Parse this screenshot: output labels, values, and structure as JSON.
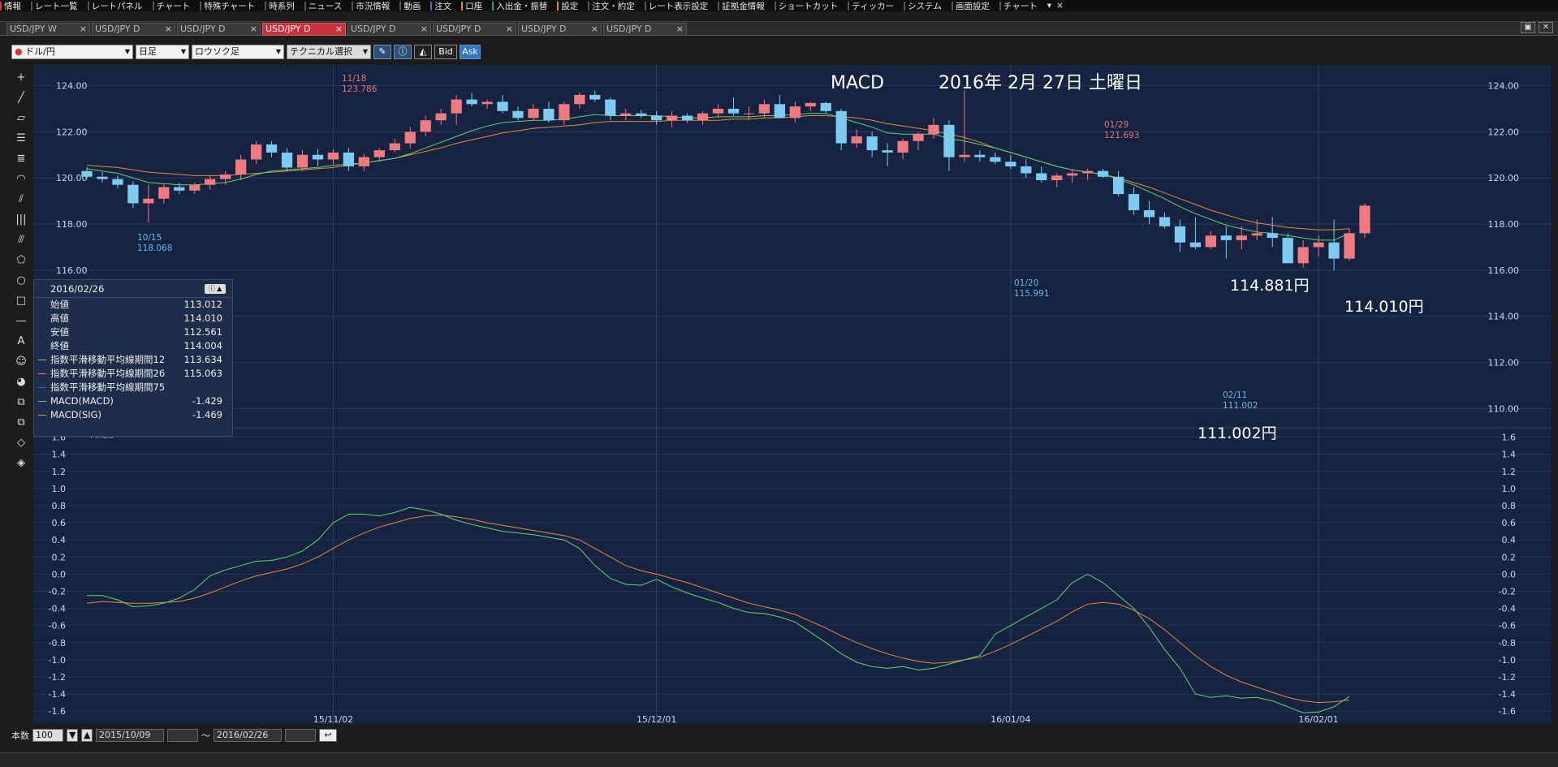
{
  "menu": [
    {
      "label": "情報",
      "color": "#d23b3b"
    },
    {
      "label": "レート一覧",
      "color": ""
    },
    {
      "label": "レートパネル",
      "color": ""
    },
    {
      "label": "チャート",
      "color": ""
    },
    {
      "label": "特殊チャート",
      "color": ""
    },
    {
      "label": "時系列",
      "color": ""
    },
    {
      "label": "ニュース",
      "color": ""
    },
    {
      "label": "市況情報",
      "color": ""
    },
    {
      "label": "動画",
      "color": ""
    },
    {
      "label": "注文",
      "color": "#9a49c9"
    },
    {
      "label": "口座",
      "color": "#e28a1f"
    },
    {
      "label": "入出金・振替",
      "color": "#3aa848"
    },
    {
      "label": "設定",
      "color": "#e28a1f"
    },
    {
      "label": "注文・約定",
      "color": ""
    },
    {
      "label": "レート表示設定",
      "color": ""
    },
    {
      "label": "証拠金情報",
      "color": ""
    },
    {
      "label": "ショートカット",
      "color": ""
    },
    {
      "label": "ティッカー",
      "color": ""
    },
    {
      "label": "システム",
      "color": ""
    },
    {
      "label": "画面設定",
      "color": ""
    },
    {
      "label": "チャート",
      "color": ""
    }
  ],
  "menu_extra": [
    "▾",
    "×"
  ],
  "tabs": [
    {
      "label": "USD/JPY W",
      "active": false
    },
    {
      "label": "USD/JPY D",
      "active": false
    },
    {
      "label": "USD/JPY D",
      "active": false
    },
    {
      "label": "USD/JPY D",
      "active": true
    },
    {
      "label": "USD/JPY D",
      "active": false
    },
    {
      "label": "USD/JPY D",
      "active": false
    },
    {
      "label": "USD/JPY D",
      "active": false
    },
    {
      "label": "USD/JPY D",
      "active": false
    }
  ],
  "tab_close": "×",
  "toolbar": {
    "currency": "ドル/円",
    "period": "日足",
    "chart_type": "ロウソク足",
    "technical": "テクニカル選択",
    "bid": "Bid",
    "ask": "Ask"
  },
  "left_tools": [
    "crosshair-icon",
    "line-icon",
    "ruler-icon",
    "horizontal-lines-icon",
    "multi-lines-icon",
    "arc-icon",
    "fan-icon",
    "vertical-lines-icon",
    "pitchfork-icon",
    "pentagon-icon",
    "circle-icon",
    "rectangle-icon",
    "hline-icon",
    "text-icon",
    "icon-stamp-icon",
    "color-icon",
    "copy-icon",
    "paste-icon",
    "eraser-icon",
    "eraser-all-icon"
  ],
  "left_tool_glyphs": [
    "+",
    "╱",
    "▱",
    "☰",
    "≣",
    "◠",
    "⫽",
    "|||",
    "⫻",
    "⬠",
    "○",
    "□",
    "—",
    "A",
    "☺",
    "◕",
    "⧉",
    "⧉",
    "◇",
    "◈"
  ],
  "annotations": {
    "title": "MACD",
    "date": "2016年 2月 27日 土曜日",
    "label_114881": "114.881円",
    "label_114010": "114.010円",
    "label_111002": "111.002円"
  },
  "markers": [
    {
      "date": "11/18",
      "price": "123.786",
      "color": "#e8707a"
    },
    {
      "date": "10/15",
      "price": "118.068",
      "color": "#6ab8e8"
    },
    {
      "date": "01/29",
      "price": "121.693",
      "color": "#e8707a"
    },
    {
      "date": "01/20",
      "price": "115.991",
      "color": "#6ab8e8"
    },
    {
      "date": "02/11",
      "price": "111.002",
      "color": "#6ab8e8"
    }
  ],
  "info_panel": {
    "date": "2016/02/26",
    "rows": [
      {
        "label": "始値",
        "value": "113.012",
        "color": ""
      },
      {
        "label": "高値",
        "value": "114.010",
        "color": ""
      },
      {
        "label": "安値",
        "value": "112.561",
        "color": ""
      },
      {
        "label": "終値",
        "value": "114.004",
        "color": ""
      },
      {
        "label": "指数平滑移動平均線期間12",
        "value": "113.634",
        "color": "#5fd66b"
      },
      {
        "label": "指数平滑移動平均線期間26",
        "value": "115.063",
        "color": "#e88a3a"
      },
      {
        "label": "指数平滑移動平均線期間75",
        "value": "",
        "color": "#3a5ae8"
      },
      {
        "label": "MACD(MACD)",
        "value": "-1.429",
        "color": "#5fd66b"
      },
      {
        "label": "MACD(SIG)",
        "value": "-1.469",
        "color": "#e88a3a"
      }
    ]
  },
  "macd_label": "MACD",
  "footer": {
    "count_label": "本数",
    "count_value": "100",
    "start_date": "2015/10/09",
    "tilde": "〜",
    "end_date": "2016/02/26"
  },
  "colors": {
    "chart_bg": "#152240",
    "up": "#f07a80",
    "down": "#7ccbf0",
    "ema12": "#5fd66b",
    "ema26": "#e88a3a"
  },
  "chart_data": {
    "type": "candlestick+macd",
    "x_ticks": [
      "15/11/02",
      "15/12/01",
      "16/01/04",
      "16/02/01"
    ],
    "x_tick_index": [
      16,
      37,
      60,
      80
    ],
    "price_ylim": [
      109.2,
      124.9
    ],
    "price_ticks": [
      "124.00",
      "122.00",
      "120.00",
      "118.00",
      "116.00",
      "114.00",
      "112.00",
      "110.00"
    ],
    "macd_ylim": [
      -1.75,
      1.7
    ],
    "macd_ticks": [
      "1.6",
      "1.4",
      "1.2",
      "1.0",
      "0.8",
      "0.6",
      "0.4",
      "0.2",
      "0.0",
      "-0.2",
      "-0.4",
      "-0.6",
      "-0.8",
      "-1.0",
      "-1.2",
      "-1.4",
      "-1.6"
    ],
    "candles": [
      [
        120.3,
        120.45,
        119.95,
        120.05
      ],
      [
        120.05,
        120.25,
        119.8,
        119.95
      ],
      [
        119.95,
        120.1,
        119.55,
        119.7
      ],
      [
        119.7,
        119.85,
        118.7,
        118.9
      ],
      [
        118.9,
        119.7,
        118.07,
        119.1
      ],
      [
        119.1,
        119.75,
        118.9,
        119.6
      ],
      [
        119.6,
        119.8,
        119.3,
        119.45
      ],
      [
        119.45,
        119.8,
        119.3,
        119.7
      ],
      [
        119.7,
        120.1,
        119.5,
        119.95
      ],
      [
        119.95,
        120.3,
        119.7,
        120.15
      ],
      [
        120.15,
        121.0,
        119.9,
        120.8
      ],
      [
        120.8,
        121.6,
        120.6,
        121.45
      ],
      [
        121.45,
        121.6,
        120.9,
        121.1
      ],
      [
        121.1,
        121.3,
        120.3,
        120.45
      ],
      [
        120.45,
        121.2,
        120.3,
        121.0
      ],
      [
        121.0,
        121.25,
        120.5,
        120.8
      ],
      [
        120.8,
        121.25,
        120.6,
        121.1
      ],
      [
        121.1,
        121.3,
        120.3,
        120.5
      ],
      [
        120.5,
        121.05,
        120.3,
        120.9
      ],
      [
        120.9,
        121.3,
        120.7,
        121.2
      ],
      [
        121.2,
        121.7,
        121.1,
        121.5
      ],
      [
        121.5,
        122.2,
        121.3,
        122.0
      ],
      [
        122.0,
        122.7,
        121.8,
        122.5
      ],
      [
        122.5,
        123.0,
        122.3,
        122.8
      ],
      [
        122.8,
        123.6,
        122.3,
        123.4
      ],
      [
        123.4,
        123.7,
        123.1,
        123.2
      ],
      [
        123.2,
        123.4,
        123.0,
        123.3
      ],
      [
        123.3,
        123.6,
        122.8,
        122.9
      ],
      [
        122.9,
        123.1,
        122.5,
        122.6
      ],
      [
        122.6,
        123.2,
        122.5,
        123.0
      ],
      [
        123.0,
        123.3,
        122.4,
        122.5
      ],
      [
        122.5,
        123.3,
        122.3,
        123.2
      ],
      [
        123.2,
        123.7,
        123.0,
        123.6
      ],
      [
        123.6,
        123.79,
        123.3,
        123.4
      ],
      [
        123.4,
        123.5,
        122.5,
        122.7
      ],
      [
        122.7,
        123.0,
        122.5,
        122.8
      ],
      [
        122.8,
        122.95,
        122.6,
        122.7
      ],
      [
        122.7,
        122.9,
        122.3,
        122.5
      ],
      [
        122.5,
        122.9,
        122.2,
        122.7
      ],
      [
        122.7,
        122.8,
        122.4,
        122.5
      ],
      [
        122.5,
        122.9,
        122.3,
        122.8
      ],
      [
        122.8,
        123.2,
        122.6,
        123.0
      ],
      [
        123.0,
        123.5,
        122.7,
        122.8
      ],
      [
        122.8,
        123.1,
        122.5,
        122.8
      ],
      [
        122.8,
        123.4,
        122.6,
        123.2
      ],
      [
        123.2,
        123.6,
        122.6,
        122.6
      ],
      [
        122.6,
        123.3,
        122.4,
        123.1
      ],
      [
        123.1,
        123.3,
        122.9,
        123.25
      ],
      [
        123.25,
        123.3,
        122.8,
        122.9
      ],
      [
        122.9,
        123.0,
        121.2,
        121.5
      ],
      [
        121.5,
        122.1,
        121.3,
        121.8
      ],
      [
        121.8,
        122.0,
        120.9,
        121.2
      ],
      [
        121.2,
        121.5,
        120.5,
        121.1
      ],
      [
        121.1,
        121.7,
        120.8,
        121.6
      ],
      [
        121.6,
        122.0,
        121.2,
        121.9
      ],
      [
        121.9,
        122.6,
        121.7,
        122.3
      ],
      [
        122.3,
        122.5,
        120.3,
        120.9
      ],
      [
        120.9,
        123.8,
        120.7,
        121.0
      ],
      [
        121.0,
        121.2,
        120.7,
        120.9
      ],
      [
        120.9,
        121.1,
        120.6,
        120.7
      ],
      [
        120.7,
        121.0,
        120.4,
        120.5
      ],
      [
        120.5,
        120.8,
        120.0,
        120.2
      ],
      [
        120.2,
        120.5,
        119.8,
        119.9
      ],
      [
        119.9,
        120.2,
        119.6,
        120.1
      ],
      [
        120.1,
        120.4,
        119.8,
        120.2
      ],
      [
        120.2,
        120.4,
        119.9,
        120.3
      ],
      [
        120.3,
        120.4,
        120.0,
        120.05
      ],
      [
        120.05,
        120.3,
        119.2,
        119.3
      ],
      [
        119.3,
        119.6,
        118.4,
        118.6
      ],
      [
        118.6,
        119.0,
        118.0,
        118.3
      ],
      [
        118.3,
        118.5,
        117.8,
        117.9
      ],
      [
        117.9,
        118.2,
        116.8,
        117.2
      ],
      [
        117.2,
        118.3,
        116.9,
        117.0
      ],
      [
        117.0,
        117.7,
        116.9,
        117.5
      ],
      [
        117.5,
        117.9,
        116.5,
        117.3
      ],
      [
        117.3,
        117.9,
        116.9,
        117.5
      ],
      [
        117.5,
        118.2,
        117.3,
        117.6
      ],
      [
        117.6,
        118.3,
        117.0,
        117.4
      ],
      [
        117.4,
        117.6,
        116.3,
        116.3
      ],
      [
        116.3,
        117.3,
        116.1,
        117.0
      ],
      [
        117.0,
        117.5,
        116.6,
        117.2
      ],
      [
        117.2,
        118.2,
        115.99,
        116.5
      ],
      [
        116.5,
        117.8,
        116.4,
        117.6
      ],
      [
        117.6,
        118.9,
        117.4,
        118.8
      ]
    ],
    "macd": [
      -0.25,
      -0.25,
      -0.3,
      -0.38,
      -0.37,
      -0.34,
      -0.28,
      -0.18,
      -0.02,
      0.05,
      0.1,
      0.15,
      0.16,
      0.2,
      0.27,
      0.4,
      0.6,
      0.7,
      0.7,
      0.68,
      0.72,
      0.78,
      0.75,
      0.7,
      0.63,
      0.58,
      0.54,
      0.5,
      0.48,
      0.46,
      0.43,
      0.4,
      0.3,
      0.1,
      -0.05,
      -0.12,
      -0.13,
      -0.06,
      -0.15,
      -0.22,
      -0.28,
      -0.33,
      -0.4,
      -0.45,
      -0.46,
      -0.5,
      -0.56,
      -0.68,
      -0.8,
      -0.93,
      -1.03,
      -1.08,
      -1.1,
      -1.08,
      -1.12,
      -1.1,
      -1.05,
      -1.0,
      -0.95,
      -0.7,
      -0.6,
      -0.5,
      -0.4,
      -0.3,
      -0.1,
      0.0,
      -0.1,
      -0.25,
      -0.4,
      -0.62,
      -0.88,
      -1.1,
      -1.4,
      -1.44,
      -1.42,
      -1.45,
      -1.44,
      -1.48,
      -1.55,
      -1.62,
      -1.61,
      -1.55,
      -1.429
    ],
    "signal": [
      -0.34,
      -0.32,
      -0.33,
      -0.34,
      -0.34,
      -0.33,
      -0.32,
      -0.28,
      -0.22,
      -0.15,
      -0.08,
      -0.02,
      0.02,
      0.06,
      0.12,
      0.2,
      0.3,
      0.4,
      0.48,
      0.55,
      0.6,
      0.65,
      0.68,
      0.69,
      0.67,
      0.64,
      0.6,
      0.57,
      0.54,
      0.51,
      0.48,
      0.45,
      0.4,
      0.3,
      0.2,
      0.1,
      0.04,
      0.0,
      -0.05,
      -0.1,
      -0.16,
      -0.22,
      -0.28,
      -0.34,
      -0.38,
      -0.42,
      -0.47,
      -0.55,
      -0.63,
      -0.72,
      -0.8,
      -0.87,
      -0.93,
      -0.98,
      -1.02,
      -1.04,
      -1.03,
      -1.0,
      -0.97,
      -0.9,
      -0.82,
      -0.73,
      -0.64,
      -0.55,
      -0.44,
      -0.35,
      -0.33,
      -0.35,
      -0.42,
      -0.52,
      -0.65,
      -0.8,
      -0.95,
      -1.08,
      -1.18,
      -1.26,
      -1.32,
      -1.38,
      -1.44,
      -1.48,
      -1.5,
      -1.49,
      -1.469
    ],
    "ema12": [
      120.4,
      120.3,
      120.2,
      120.0,
      119.8,
      119.75,
      119.7,
      119.7,
      119.75,
      119.8,
      119.95,
      120.15,
      120.3,
      120.35,
      120.4,
      120.45,
      120.55,
      120.6,
      120.65,
      120.75,
      120.85,
      121.05,
      121.3,
      121.55,
      121.8,
      122.05,
      122.25,
      122.4,
      122.45,
      122.5,
      122.5,
      122.55,
      122.65,
      122.75,
      122.7,
      122.7,
      122.7,
      122.7,
      122.65,
      122.6,
      122.6,
      122.65,
      122.65,
      122.65,
      122.7,
      122.7,
      122.75,
      122.8,
      122.8,
      122.6,
      122.4,
      122.2,
      121.95,
      121.9,
      121.9,
      121.9,
      121.7,
      121.6,
      121.45,
      121.3,
      121.1,
      120.9,
      120.7,
      120.5,
      120.35,
      120.25,
      120.15,
      119.95,
      119.7,
      119.4,
      119.1,
      118.75,
      118.45,
      118.2,
      117.95,
      117.8,
      117.65,
      117.6,
      117.5,
      117.4,
      117.3,
      117.3,
      117.6
    ],
    "ema26": [
      120.55,
      120.5,
      120.45,
      120.35,
      120.25,
      120.2,
      120.15,
      120.1,
      120.1,
      120.1,
      120.15,
      120.2,
      120.25,
      120.3,
      120.35,
      120.4,
      120.45,
      120.55,
      120.65,
      120.75,
      120.85,
      121.0,
      121.15,
      121.3,
      121.5,
      121.65,
      121.8,
      121.95,
      122.05,
      122.15,
      122.2,
      122.25,
      122.3,
      122.4,
      122.45,
      122.45,
      122.45,
      122.45,
      122.5,
      122.5,
      122.5,
      122.5,
      122.55,
      122.55,
      122.6,
      122.6,
      122.65,
      122.7,
      122.7,
      122.65,
      122.6,
      122.5,
      122.35,
      122.25,
      122.15,
      122.05,
      121.9,
      121.75,
      121.55,
      121.3,
      121.1,
      120.9,
      120.7,
      120.5,
      120.35,
      120.25,
      120.15,
      120.0,
      119.8,
      119.6,
      119.35,
      119.1,
      118.85,
      118.6,
      118.4,
      118.2,
      118.05,
      117.95,
      117.85,
      117.8,
      117.75,
      117.75,
      117.8
    ]
  }
}
